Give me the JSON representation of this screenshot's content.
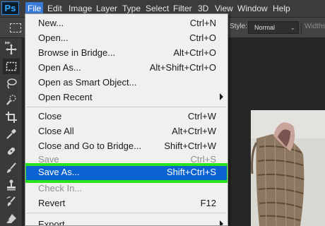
{
  "menubar": {
    "logo": "Ps",
    "items": [
      "File",
      "Edit",
      "Image",
      "Layer",
      "Type",
      "Select",
      "Filter",
      "3D",
      "View",
      "Window",
      "Help"
    ]
  },
  "options_bar": {
    "style_label": "Style:",
    "style_value": "Normal",
    "widths_label": "Widths"
  },
  "file_menu": {
    "items": [
      {
        "label": "New...",
        "shortcut": "Ctrl+N"
      },
      {
        "label": "Open...",
        "shortcut": "Ctrl+O"
      },
      {
        "label": "Browse in Bridge...",
        "shortcut": "Alt+Ctrl+O"
      },
      {
        "label": "Open As...",
        "shortcut": "Alt+Shift+Ctrl+O"
      },
      {
        "label": "Open as Smart Object..."
      },
      {
        "label": "Open Recent"
      },
      {
        "label": "Close",
        "shortcut": "Ctrl+W"
      },
      {
        "label": "Close All",
        "shortcut": "Alt+Ctrl+W"
      },
      {
        "label": "Close and Go to Bridge...",
        "shortcut": "Shift+Ctrl+W"
      },
      {
        "label": "Save",
        "shortcut": "Ctrl+S"
      },
      {
        "label": "Save As...",
        "shortcut": "Shift+Ctrl+S"
      },
      {
        "label": "Check In..."
      },
      {
        "label": "Revert",
        "shortcut": "F12"
      },
      {
        "label": "Export"
      }
    ]
  },
  "colors": {
    "highlight": "#0a63d1",
    "highlight_outline": "#28e31e",
    "menubar_bg": "#3c3c3c",
    "ps_blue": "#31a8ff"
  },
  "tools": [
    "move-icon",
    "rectangular-marquee-icon",
    "lasso-icon",
    "quick-selection-icon",
    "crop-icon",
    "eyedropper-icon",
    "healing-brush-icon",
    "brush-icon",
    "clone-stamp-icon",
    "history-brush-icon",
    "eraser-icon"
  ]
}
